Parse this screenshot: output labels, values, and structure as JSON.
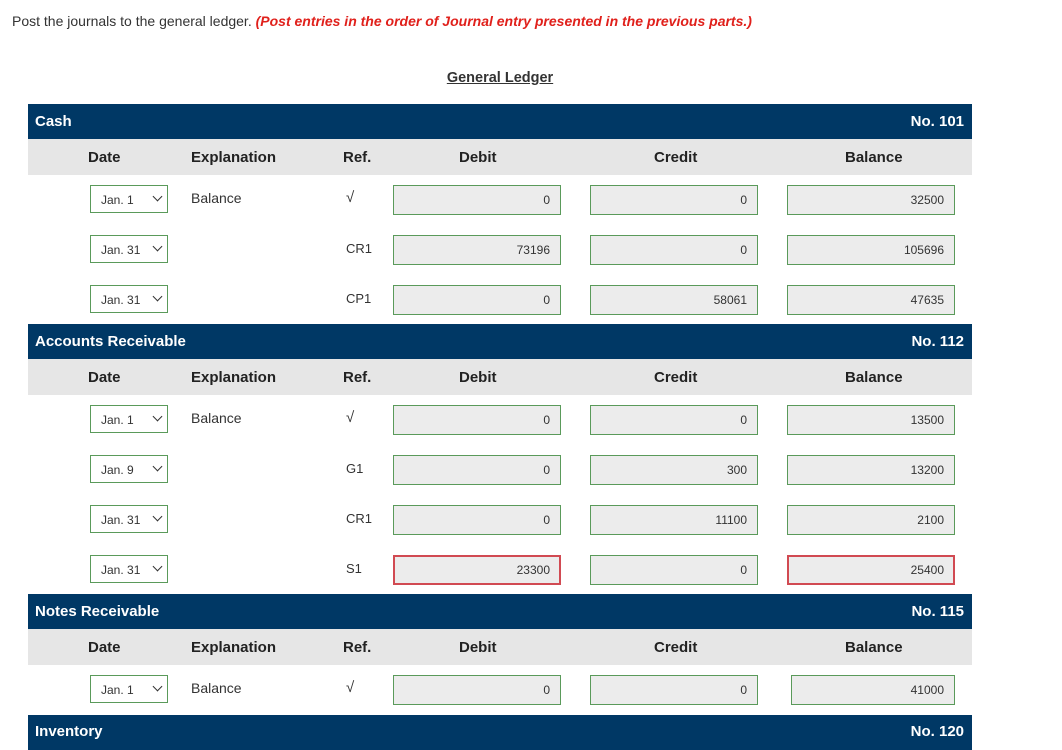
{
  "instruction": {
    "text": "Post the journals to the general ledger.",
    "emphasis": "(Post entries in the order of Journal entry presented in the previous parts.)"
  },
  "ledger_title": "General Ledger",
  "columns": {
    "date": "Date",
    "explanation": "Explanation",
    "ref": "Ref.",
    "debit": "Debit",
    "credit": "Credit",
    "balance": "Balance"
  },
  "accounts": [
    {
      "name": "Cash",
      "number": "No. 101",
      "rows": [
        {
          "date": "Jan. 1",
          "explanation": "Balance",
          "ref": "√",
          "debit": "0",
          "credit": "0",
          "balance": "32500"
        },
        {
          "date": "Jan. 31",
          "explanation": "",
          "ref": "CR1",
          "debit": "73196",
          "credit": "0",
          "balance": "105696"
        },
        {
          "date": "Jan. 31",
          "explanation": "",
          "ref": "CP1",
          "debit": "0",
          "credit": "58061",
          "balance": "47635"
        }
      ]
    },
    {
      "name": "Accounts Receivable",
      "number": "No. 112",
      "rows": [
        {
          "date": "Jan. 1",
          "explanation": "Balance",
          "ref": "√",
          "debit": "0",
          "credit": "0",
          "balance": "13500"
        },
        {
          "date": "Jan. 9",
          "explanation": "",
          "ref": "G1",
          "debit": "0",
          "credit": "300",
          "balance": "13200"
        },
        {
          "date": "Jan. 31",
          "explanation": "",
          "ref": "CR1",
          "debit": "0",
          "credit": "11100",
          "balance": "2100"
        },
        {
          "date": "Jan. 31",
          "explanation": "",
          "ref": "S1",
          "debit": "23300",
          "credit": "0",
          "balance": "25400",
          "debit_error": true,
          "balance_error": true
        }
      ]
    },
    {
      "name": "Notes Receivable",
      "number": "No. 115",
      "rows": [
        {
          "date": "Jan. 1",
          "explanation": "Balance",
          "ref": "√",
          "debit": "0",
          "credit": "0",
          "balance": "41000"
        }
      ]
    },
    {
      "name": "Inventory",
      "number": "No. 120",
      "rows": []
    }
  ],
  "colors": {
    "header_bg": "#003865",
    "column_header_bg": "#e6e6e6",
    "field_border": "#5a9a5a",
    "error_border": "#d14a52",
    "emphasis_text": "#e0201b"
  }
}
